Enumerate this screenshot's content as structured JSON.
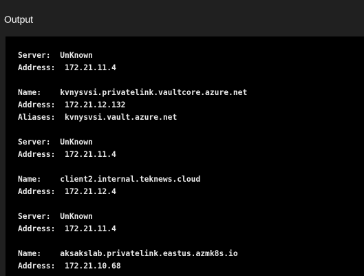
{
  "panel": {
    "title": "Output"
  },
  "console": {
    "lines": [
      "Server:  UnKnown",
      "Address:  172.21.11.4",
      "",
      "Name:    kvnysvsi.privatelink.vaultcore.azure.net",
      "Address:  172.21.12.132",
      "Aliases:  kvnysvsi.vault.azure.net",
      "",
      "Server:  UnKnown",
      "Address:  172.21.11.4",
      "",
      "Name:    client2.internal.teknews.cloud",
      "Address:  172.21.12.4",
      "",
      "Server:  UnKnown",
      "Address:  172.21.11.4",
      "",
      "Name:    aksakslab.privatelink.eastus.azmk8s.io",
      "Address:  172.21.10.68"
    ]
  }
}
